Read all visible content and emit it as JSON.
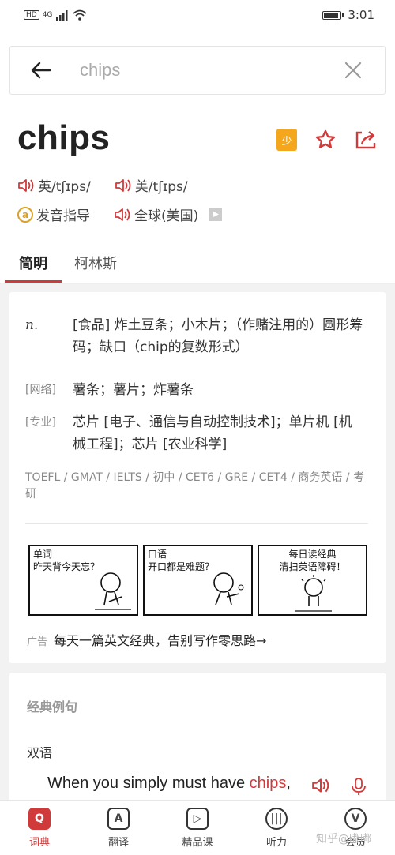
{
  "status": {
    "hd": "HD",
    "net": "4G",
    "time": "3:01"
  },
  "search": {
    "query": "chips"
  },
  "entry": {
    "word": "chips",
    "badge": "少",
    "pron": [
      {
        "label": "英/tʃɪps/"
      },
      {
        "label": "美/tʃɪps/"
      }
    ],
    "guide_label": "发音指导",
    "global_label": "全球(美国)"
  },
  "tabs": [
    "简明",
    "柯林斯"
  ],
  "definitions": {
    "main": {
      "pos": "n.",
      "text": "[食品] 炸土豆条；小木片；（作赌注用的）圆形筹码；缺口（chip的复数形式）"
    },
    "web": {
      "tag": "[网络]",
      "text": "薯条；薯片；炸薯条"
    },
    "pro": {
      "tag": "[专业]",
      "text": "芯片 [电子、通信与自动控制技术]；单片机 [机械工程]；芯片 [农业科学]"
    },
    "exams": "TOEFL / GMAT / IELTS / 初中 / CET6 / GRE / CET4 / 商务英语 / 考研"
  },
  "comics": [
    {
      "line1": "单词",
      "line2": "昨天背今天忘？"
    },
    {
      "line1": "口语",
      "line2": "开口都是难题？"
    },
    {
      "line1": "每日读经典",
      "line2": "清扫英语障碍！"
    }
  ],
  "ad": {
    "tag": "广告",
    "text": "每天一篇英文经典，告别写作零思路→"
  },
  "examples": {
    "title": "经典例句",
    "subtitle": "双语",
    "sentence_pre": "When you simply must have ",
    "sentence_hl": "chips",
    "sentence_post": ","
  },
  "nav": [
    {
      "label": "词典",
      "icon": "Q"
    },
    {
      "label": "翻译",
      "icon": "A"
    },
    {
      "label": "精品课",
      "icon": "▷"
    },
    {
      "label": "听力",
      "icon": "|||"
    },
    {
      "label": "会员",
      "icon": "V"
    }
  ],
  "watermark": "知乎@嘟嘟"
}
